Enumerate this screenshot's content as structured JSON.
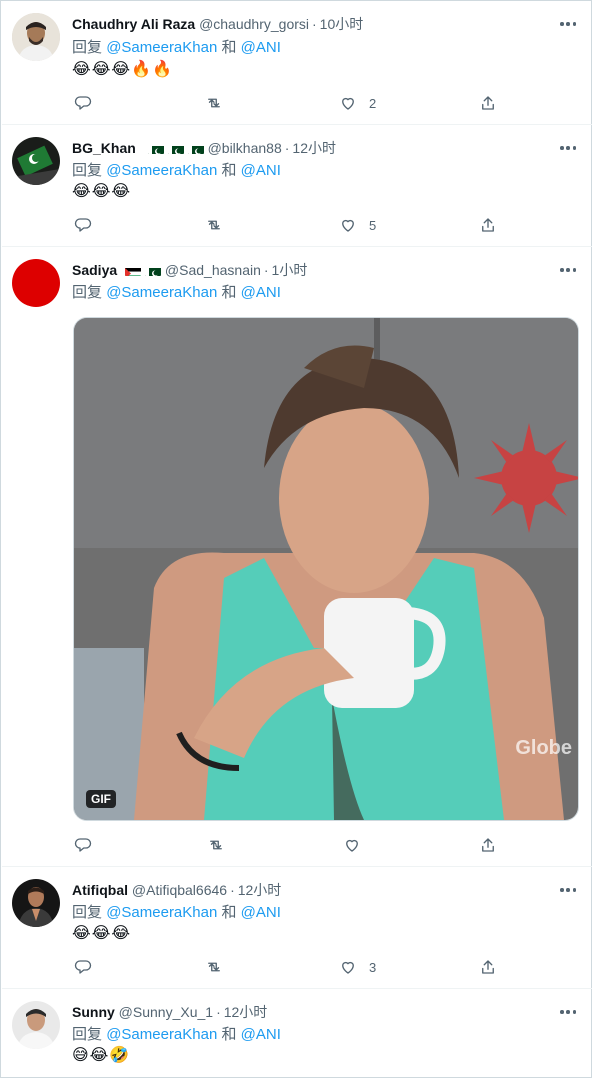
{
  "reply_prefix": "回复",
  "reply_conjunction": "和",
  "gif_label": "GIF",
  "watermark": "Globe",
  "colors": {
    "link": "#1d9bf0",
    "muted": "#536471",
    "pk_green": "#01411c",
    "red_avatar": "#dd0000"
  },
  "tweets": [
    {
      "name": "Chaudhry Ali Raza",
      "handle": "@chaudhry_gorsi",
      "time": "10小时",
      "mentions": [
        "@SameeraKhan",
        "@ANI"
      ],
      "emojis": "😂😂😂🔥🔥",
      "likes": "2"
    },
    {
      "name": "BG_Khan",
      "flags": [
        "pakistan-flag",
        "pakistan-flag",
        "pakistan-flag"
      ],
      "handle": "@bilkhan88",
      "time": "12小时",
      "mentions": [
        "@SameeraKhan",
        "@ANI"
      ],
      "emojis": "😂😂😂",
      "likes": "5"
    },
    {
      "name": "Sadiya",
      "flags": [
        "palestine-flag",
        "pakistan-flag"
      ],
      "handle": "@Sad_hasnain",
      "time": "1小时",
      "mentions": [
        "@SameeraKhan",
        "@ANI"
      ],
      "emojis": "",
      "likes": ""
    },
    {
      "name": "Atifiqbal",
      "handle": "@Atifiqbal6646",
      "time": "12小时",
      "mentions": [
        "@SameeraKhan",
        "@ANI"
      ],
      "emojis": "😂😂😂",
      "likes": "3"
    },
    {
      "name": "Sunny",
      "handle": "@Sunny_Xu_1",
      "time": "12小时",
      "mentions": [
        "@SameeraKhan",
        "@ANI"
      ],
      "emojis": "😅😂🤣",
      "likes": ""
    }
  ]
}
